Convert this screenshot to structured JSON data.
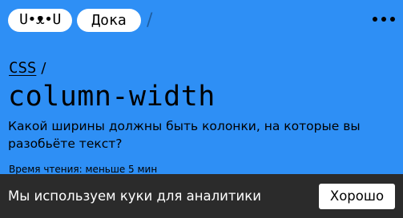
{
  "header": {
    "logo_text": "U•ᴥ•U",
    "site_name": "Дока",
    "separator": "/",
    "menu_icon": "more-dots-icon"
  },
  "breadcrumb": {
    "section": "CSS",
    "separator": "/"
  },
  "article": {
    "title": "column-width",
    "description": "Какой ширины должны быть колонки, на которые вы разобьёте текст?",
    "reading_time": "Время чтения: меньше 5 мин"
  },
  "cookie_banner": {
    "text": "Мы используем куки для аналитики",
    "accept_label": "Хорошо"
  },
  "colors": {
    "background": "#2e8ff5",
    "banner": "#2b2b2b",
    "pill": "#ffffff"
  }
}
